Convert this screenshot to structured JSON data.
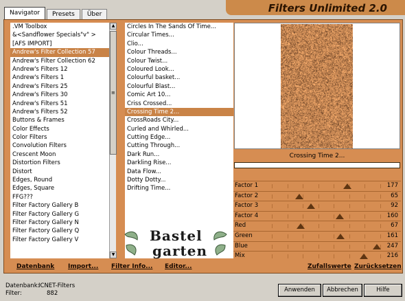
{
  "tabs": [
    "Navigator",
    "Presets",
    "Über"
  ],
  "app_title": "Filters Unlimited 2.0",
  "categories": [
    ".VM Toolbox",
    "&<Sandflower Specials\"v\" >",
    "[AFS IMPORT]",
    "Andrew's Filter Collection 57",
    "Andrew's Filter Collection 62",
    "Andrew's Filters 12",
    "Andrew's Filters 1",
    "Andrew's Filters 25",
    "Andrew's Filters 30",
    "Andrew's Filters 51",
    "Andrew's Filters 52",
    "Buttons & Frames",
    "Color Effects",
    "Color Filters",
    "Convolution Filters",
    "Crescent Moon",
    "Distortion Filters",
    "Distort",
    "Edges, Round",
    "Edges, Square",
    "FFG???",
    "Filter Factory Gallery B",
    "Filter Factory Gallery G",
    "Filter Factory Gallery N",
    "Filter Factory Gallery Q",
    "Filter Factory Gallery V"
  ],
  "selected_category": "Andrew's Filter Collection 57",
  "filters": [
    "Circles In The Sands Of Time...",
    "Circular Times...",
    "Clio...",
    "Colour Threads...",
    "Colour Twist...",
    "Coloured Look...",
    "Colourful basket...",
    "Colourful Blast...",
    "Comic Art 10...",
    "Criss Crossed...",
    "Crossing Time 2...",
    "CrossRoads City...",
    "Curled and Whirled...",
    "Cutting Edge...",
    "Cutting Through...",
    "Dark Run...",
    "Darkling Rise...",
    "Data Flow...",
    "Dotty Dotty...",
    "Drifting Time..."
  ],
  "selected_filter": "Crossing Time 2...",
  "preview": {
    "filter_name": "Crossing Time 2...",
    "progress": 0
  },
  "sliders": [
    {
      "label": "Factor 1",
      "value": 177
    },
    {
      "label": "Factor 2",
      "value": 65
    },
    {
      "label": "Factor 3",
      "value": 92
    },
    {
      "label": "Factor 4",
      "value": 160
    },
    {
      "label": "Red",
      "value": 67
    },
    {
      "label": "Green",
      "value": 161
    },
    {
      "label": "Blue",
      "value": 247
    },
    {
      "label": "Mix",
      "value": 216
    }
  ],
  "panel_buttons": {
    "datenbank": "Datenbank",
    "import": "Import...",
    "filter_info": "Filter Info...",
    "editor": "Editor...",
    "zufallswerte": "Zufallswerte",
    "zuruecksetzen": "Zurücksetzen"
  },
  "status": {
    "db_label": "Datenbank:",
    "db_value": "ICNET-Filters",
    "filter_label": "Filter:",
    "filter_value": "882"
  },
  "buttons": {
    "apply": "Anwenden",
    "cancel": "Abbrechen",
    "help": "Hilfe"
  },
  "watermark": {
    "line1": "Bastel",
    "line2": "garten"
  },
  "colors": {
    "panel": "#d68d52",
    "selection": "#c98347",
    "title_bg": "#cc8a4a"
  }
}
